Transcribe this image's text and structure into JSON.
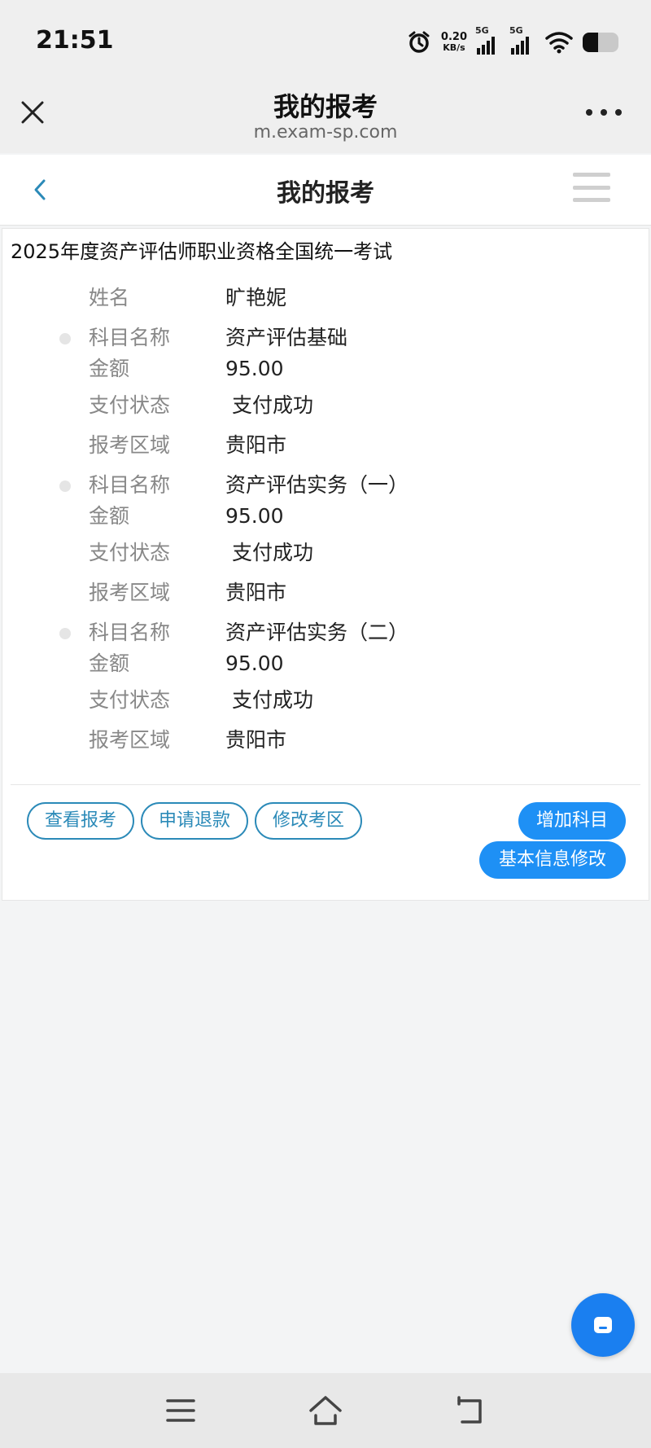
{
  "status_bar": {
    "time": "21:51",
    "net_speed_value": "0.20",
    "net_speed_unit": "KB/s",
    "signal1_label": "5G",
    "signal2_label": "5G",
    "battery_level": 0.44
  },
  "browser": {
    "title": "我的报考",
    "url": "m.exam-sp.com"
  },
  "page": {
    "title": "我的报考"
  },
  "exam": {
    "title": "2025年度资产评估师职业资格全国统一考试",
    "name_label": "姓名",
    "name_value": "旷艳妮",
    "subjects": [
      {
        "subject_label": "科目名称",
        "subject_value": "资产评估基础",
        "amount_label": "金额",
        "amount_value": "95.00",
        "status_label": "支付状态",
        "status_value": "支付成功",
        "region_label": "报考区域",
        "region_value": "贵阳市"
      },
      {
        "subject_label": "科目名称",
        "subject_value": "资产评估实务（一）",
        "amount_label": "金额",
        "amount_value": "95.00",
        "status_label": "支付状态",
        "status_value": "支付成功",
        "region_label": "报考区域",
        "region_value": "贵阳市"
      },
      {
        "subject_label": "科目名称",
        "subject_value": "资产评估实务（二）",
        "amount_label": "金额",
        "amount_value": "95.00",
        "status_label": "支付状态",
        "status_value": "支付成功",
        "region_label": "报考区域",
        "region_value": "贵阳市"
      }
    ]
  },
  "actions": {
    "view": "查看报考",
    "refund": "申请退款",
    "change_region": "修改考区",
    "add_subject": "增加科目",
    "edit_info": "基本信息修改"
  },
  "colors": {
    "primary": "#1e90f5",
    "outline": "#2b8ab8",
    "fab": "#1a7ff0"
  },
  "icons": {
    "close": "close-icon",
    "more": "more-icon",
    "back": "chevron-left-icon",
    "menu": "menu-icon",
    "chat": "chat-icon",
    "nav_menu": "menu-icon",
    "nav_home": "home-icon",
    "nav_back": "back-icon"
  }
}
